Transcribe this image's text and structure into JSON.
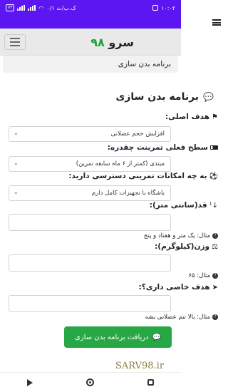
{
  "status_bar": {
    "battery": "۷۴",
    "network_speed": "۰/۱ ک.ب/ث",
    "clock": "۱۰:۰۲"
  },
  "brand": {
    "name": "سرو",
    "number": "۹۸"
  },
  "breadcrumb": "برنامه بدن سازی",
  "form": {
    "heading": "برنامه بدن سازی",
    "goal_label": "هدف اصلی:",
    "goal_value": "افزایش حجم عضلانی",
    "level_label": "سطح فعلی تمرینت چقدره:",
    "level_value": "مبتدی (کمتر از ۶ ماه سابقه تمرین)",
    "equipment_label": "به چه امکانات تمرینی دسترسی دارید:",
    "equipment_value": "باشگاه با تجهیزات کامل دارم",
    "height_label": "قد(سانتی متر):",
    "height_help": "مثال: یک متر و هفتاد و پنج",
    "weight_label": "وزن(کیلوگرم):",
    "weight_help": "مثال: ۶۵",
    "special_goal_label": "هدف خاصی داری؟:",
    "special_goal_help": "مثال: بالا تنم عضلانی بشه",
    "submit_label": "دریافت برنامه بدن سازی"
  },
  "watermark": "SARV98.ir",
  "icons": {
    "heading": "comments-icon",
    "goal": "flag-icon",
    "level": "battery-icon",
    "equipment": "soccer-ball-icon",
    "height": "sort-numeric-icon",
    "weight": "balance-scale-icon",
    "special_goal": "paper-plane-icon",
    "help": "question-circle-icon",
    "submit": "chat-icon"
  },
  "colors": {
    "status_bar": "#5b16f1",
    "brand_number": "#1aa235",
    "submit": "#28a745"
  }
}
